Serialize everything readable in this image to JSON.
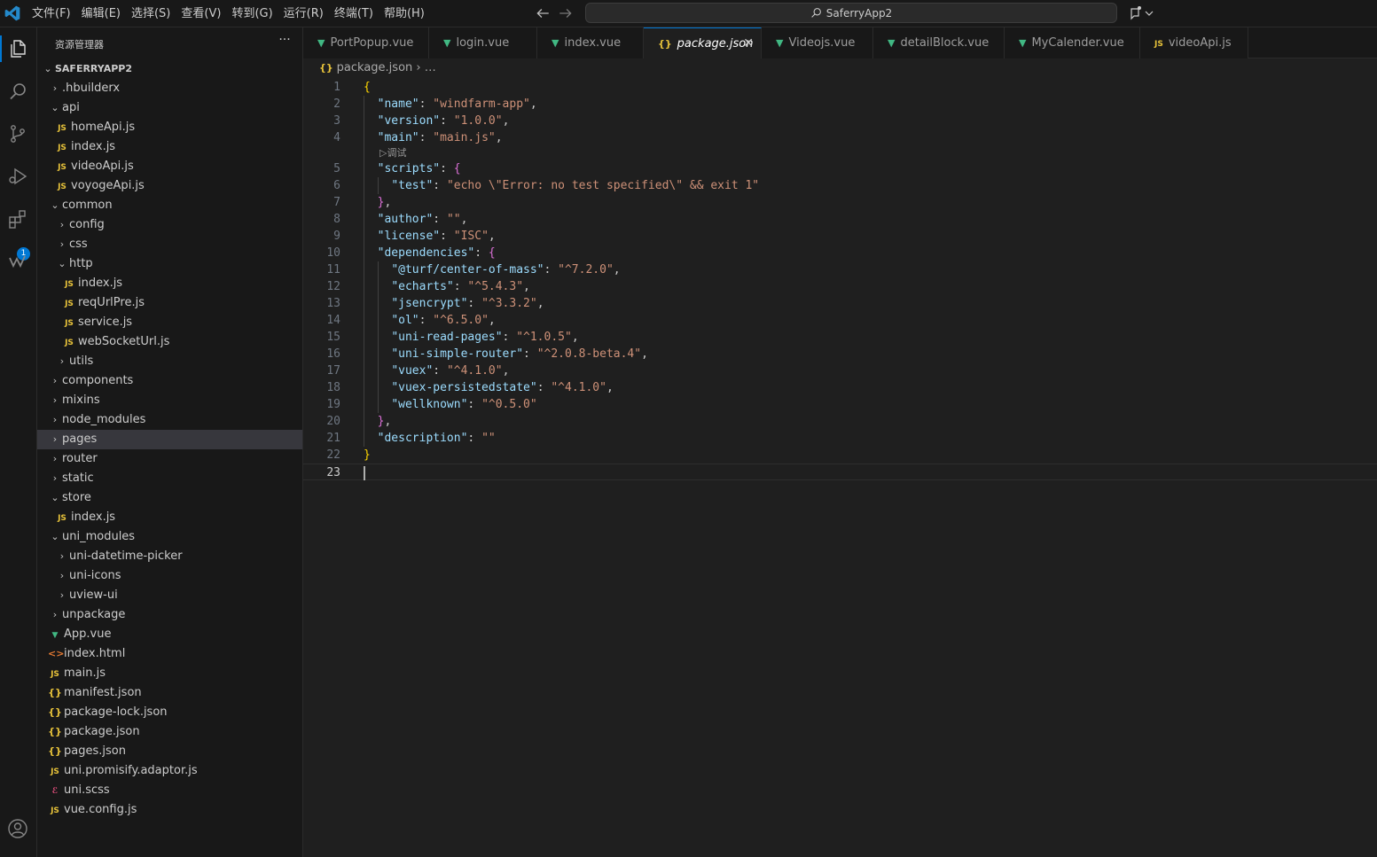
{
  "titlebar": {
    "menu": [
      "文件(F)",
      "编辑(E)",
      "选择(S)",
      "查看(V)",
      "转到(G)",
      "运行(R)",
      "终端(T)",
      "帮助(H)"
    ],
    "search_text": "SaferryApp2"
  },
  "activity": {
    "extensions_badge": "1"
  },
  "sidebar": {
    "title": "资源管理器",
    "more": "···",
    "root": "SAFERRYAPP2",
    "tree": [
      {
        "label": ".hbuilderx",
        "type": "folder",
        "open": false,
        "depth": 1
      },
      {
        "label": "api",
        "type": "folder",
        "open": true,
        "depth": 1
      },
      {
        "label": "homeApi.js",
        "type": "js",
        "depth": 2
      },
      {
        "label": "index.js",
        "type": "js",
        "depth": 2
      },
      {
        "label": "videoApi.js",
        "type": "js",
        "depth": 2
      },
      {
        "label": "voyogeApi.js",
        "type": "js",
        "depth": 2
      },
      {
        "label": "common",
        "type": "folder",
        "open": true,
        "depth": 1
      },
      {
        "label": "config",
        "type": "folder",
        "open": false,
        "depth": 2
      },
      {
        "label": "css",
        "type": "folder",
        "open": false,
        "depth": 2
      },
      {
        "label": "http",
        "type": "folder",
        "open": true,
        "depth": 2
      },
      {
        "label": "index.js",
        "type": "js",
        "depth": 3
      },
      {
        "label": "reqUrlPre.js",
        "type": "js",
        "depth": 3
      },
      {
        "label": "service.js",
        "type": "js",
        "depth": 3
      },
      {
        "label": "webSocketUrl.js",
        "type": "js",
        "depth": 3
      },
      {
        "label": "utils",
        "type": "folder",
        "open": false,
        "depth": 2
      },
      {
        "label": "components",
        "type": "folder",
        "open": false,
        "depth": 1
      },
      {
        "label": "mixins",
        "type": "folder",
        "open": false,
        "depth": 1
      },
      {
        "label": "node_modules",
        "type": "folder",
        "open": false,
        "depth": 1
      },
      {
        "label": "pages",
        "type": "folder",
        "open": false,
        "depth": 1,
        "selected": true
      },
      {
        "label": "router",
        "type": "folder",
        "open": false,
        "depth": 1
      },
      {
        "label": "static",
        "type": "folder",
        "open": false,
        "depth": 1
      },
      {
        "label": "store",
        "type": "folder",
        "open": true,
        "depth": 1
      },
      {
        "label": "index.js",
        "type": "js",
        "depth": 2
      },
      {
        "label": "uni_modules",
        "type": "folder",
        "open": true,
        "depth": 1
      },
      {
        "label": "uni-datetime-picker",
        "type": "folder",
        "open": false,
        "depth": 2
      },
      {
        "label": "uni-icons",
        "type": "folder",
        "open": false,
        "depth": 2
      },
      {
        "label": "uview-ui",
        "type": "folder",
        "open": false,
        "depth": 2
      },
      {
        "label": "unpackage",
        "type": "folder",
        "open": false,
        "depth": 1
      },
      {
        "label": "App.vue",
        "type": "vue",
        "depth": 1
      },
      {
        "label": "index.html",
        "type": "html",
        "depth": 1
      },
      {
        "label": "main.js",
        "type": "js",
        "depth": 1
      },
      {
        "label": "manifest.json",
        "type": "json",
        "depth": 1
      },
      {
        "label": "package-lock.json",
        "type": "json",
        "depth": 1
      },
      {
        "label": "package.json",
        "type": "json",
        "depth": 1
      },
      {
        "label": "pages.json",
        "type": "json",
        "depth": 1
      },
      {
        "label": "uni.promisify.adaptor.js",
        "type": "js",
        "depth": 1
      },
      {
        "label": "uni.scss",
        "type": "scss",
        "depth": 1
      },
      {
        "label": "vue.config.js",
        "type": "js",
        "depth": 1
      }
    ]
  },
  "tabs": [
    {
      "label": "PortPopup.vue",
      "type": "vue"
    },
    {
      "label": "login.vue",
      "type": "vue"
    },
    {
      "label": "index.vue",
      "type": "vue"
    },
    {
      "label": "package.json",
      "type": "json",
      "active": true
    },
    {
      "label": "Videojs.vue",
      "type": "vue"
    },
    {
      "label": "detailBlock.vue",
      "type": "vue"
    },
    {
      "label": "MyCalender.vue",
      "type": "vue"
    },
    {
      "label": "videoApi.js",
      "type": "js"
    }
  ],
  "breadcrumb": {
    "file": "package.json",
    "rest": "…"
  },
  "editor": {
    "codelens": "▷调试",
    "lines": [
      {
        "n": "1",
        "tokens": [
          [
            "b1",
            "{"
          ]
        ]
      },
      {
        "n": "2",
        "tokens": [
          [
            "p",
            "  "
          ],
          [
            "k",
            "\"name\""
          ],
          [
            "p",
            ": "
          ],
          [
            "s",
            "\"windfarm-app\""
          ],
          [
            "p",
            ","
          ]
        ]
      },
      {
        "n": "3",
        "tokens": [
          [
            "p",
            "  "
          ],
          [
            "k",
            "\"version\""
          ],
          [
            "p",
            ": "
          ],
          [
            "s",
            "\"1.0.0\""
          ],
          [
            "p",
            ","
          ]
        ]
      },
      {
        "n": "4",
        "tokens": [
          [
            "p",
            "  "
          ],
          [
            "k",
            "\"main\""
          ],
          [
            "p",
            ": "
          ],
          [
            "s",
            "\"main.js\""
          ],
          [
            "p",
            ","
          ]
        ]
      },
      {
        "n": "5",
        "tokens": [
          [
            "p",
            "  "
          ],
          [
            "k",
            "\"scripts\""
          ],
          [
            "p",
            ": "
          ],
          [
            "b2",
            "{"
          ]
        ]
      },
      {
        "n": "6",
        "tokens": [
          [
            "p",
            "    "
          ],
          [
            "k",
            "\"test\""
          ],
          [
            "p",
            ": "
          ],
          [
            "s",
            "\"echo \\\"Error: no test specified\\\" && exit 1\""
          ]
        ]
      },
      {
        "n": "7",
        "tokens": [
          [
            "p",
            "  "
          ],
          [
            "b2",
            "}"
          ],
          [
            "p",
            ","
          ]
        ]
      },
      {
        "n": "8",
        "tokens": [
          [
            "p",
            "  "
          ],
          [
            "k",
            "\"author\""
          ],
          [
            "p",
            ": "
          ],
          [
            "s",
            "\"\""
          ],
          [
            "p",
            ","
          ]
        ]
      },
      {
        "n": "9",
        "tokens": [
          [
            "p",
            "  "
          ],
          [
            "k",
            "\"license\""
          ],
          [
            "p",
            ": "
          ],
          [
            "s",
            "\"ISC\""
          ],
          [
            "p",
            ","
          ]
        ]
      },
      {
        "n": "10",
        "tokens": [
          [
            "p",
            "  "
          ],
          [
            "k",
            "\"dependencies\""
          ],
          [
            "p",
            ": "
          ],
          [
            "b2",
            "{"
          ]
        ]
      },
      {
        "n": "11",
        "tokens": [
          [
            "p",
            "    "
          ],
          [
            "k",
            "\"@turf/center-of-mass\""
          ],
          [
            "p",
            ": "
          ],
          [
            "s",
            "\"^7.2.0\""
          ],
          [
            "p",
            ","
          ]
        ]
      },
      {
        "n": "12",
        "tokens": [
          [
            "p",
            "    "
          ],
          [
            "k",
            "\"echarts\""
          ],
          [
            "p",
            ": "
          ],
          [
            "s",
            "\"^5.4.3\""
          ],
          [
            "p",
            ","
          ]
        ]
      },
      {
        "n": "13",
        "tokens": [
          [
            "p",
            "    "
          ],
          [
            "k",
            "\"jsencrypt\""
          ],
          [
            "p",
            ": "
          ],
          [
            "s",
            "\"^3.3.2\""
          ],
          [
            "p",
            ","
          ]
        ]
      },
      {
        "n": "14",
        "tokens": [
          [
            "p",
            "    "
          ],
          [
            "k",
            "\"ol\""
          ],
          [
            "p",
            ": "
          ],
          [
            "s",
            "\"^6.5.0\""
          ],
          [
            "p",
            ","
          ]
        ]
      },
      {
        "n": "15",
        "tokens": [
          [
            "p",
            "    "
          ],
          [
            "k",
            "\"uni-read-pages\""
          ],
          [
            "p",
            ": "
          ],
          [
            "s",
            "\"^1.0.5\""
          ],
          [
            "p",
            ","
          ]
        ]
      },
      {
        "n": "16",
        "tokens": [
          [
            "p",
            "    "
          ],
          [
            "k",
            "\"uni-simple-router\""
          ],
          [
            "p",
            ": "
          ],
          [
            "s",
            "\"^2.0.8-beta.4\""
          ],
          [
            "p",
            ","
          ]
        ]
      },
      {
        "n": "17",
        "tokens": [
          [
            "p",
            "    "
          ],
          [
            "k",
            "\"vuex\""
          ],
          [
            "p",
            ": "
          ],
          [
            "s",
            "\"^4.1.0\""
          ],
          [
            "p",
            ","
          ]
        ]
      },
      {
        "n": "18",
        "tokens": [
          [
            "p",
            "    "
          ],
          [
            "k",
            "\"vuex-persistedstate\""
          ],
          [
            "p",
            ": "
          ],
          [
            "s",
            "\"^4.1.0\""
          ],
          [
            "p",
            ","
          ]
        ]
      },
      {
        "n": "19",
        "tokens": [
          [
            "p",
            "    "
          ],
          [
            "k",
            "\"wellknown\""
          ],
          [
            "p",
            ": "
          ],
          [
            "s",
            "\"^0.5.0\""
          ]
        ]
      },
      {
        "n": "20",
        "tokens": [
          [
            "p",
            "  "
          ],
          [
            "b2",
            "}"
          ],
          [
            "p",
            ","
          ]
        ]
      },
      {
        "n": "21",
        "tokens": [
          [
            "p",
            "  "
          ],
          [
            "k",
            "\"description\""
          ],
          [
            "p",
            ": "
          ],
          [
            "s",
            "\"\""
          ]
        ]
      },
      {
        "n": "22",
        "tokens": [
          [
            "b1",
            "}"
          ]
        ]
      },
      {
        "n": "23",
        "tokens": [],
        "current": true
      }
    ]
  },
  "colors": {
    "accent": "#0078d4",
    "key": "#9cdcfe",
    "string": "#ce9178",
    "brace": "#ffd700",
    "brace2": "#da70d6"
  }
}
